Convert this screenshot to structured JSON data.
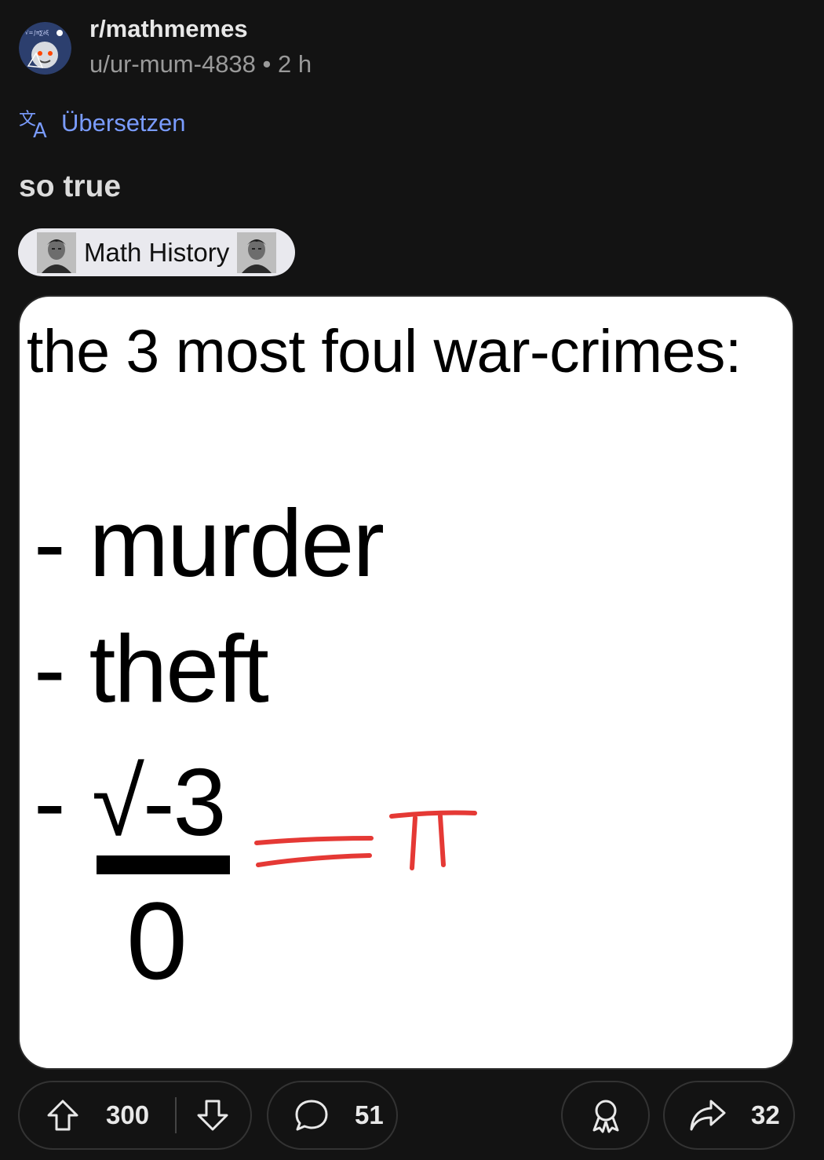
{
  "header": {
    "subreddit": "r/mathmemes",
    "author": "u/ur-mum-4838",
    "separator": "•",
    "age": "2 h"
  },
  "translate": {
    "label": "Übersetzen",
    "color": "#7a9cff"
  },
  "post": {
    "title": "so true",
    "flair": "Math History"
  },
  "meme": {
    "heading": "the 3 most foul war-crimes:",
    "items": [
      "- murder",
      "- theft"
    ],
    "third_dash": "-",
    "numerator": "√-3",
    "denominator": "0",
    "annotation": "=π",
    "annotation_color": "#e53935"
  },
  "actions": {
    "upvotes": "300",
    "comments": "51",
    "shares": "32"
  },
  "colors": {
    "background": "#131313",
    "text": "#e8e8e8",
    "muted": "#9a9a9a"
  }
}
